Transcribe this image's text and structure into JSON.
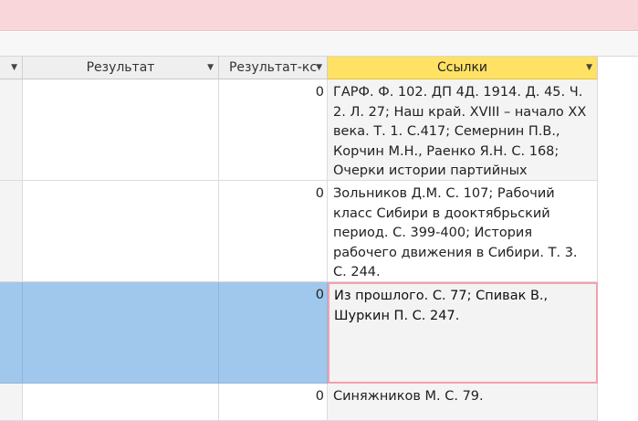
{
  "columns": {
    "result": "Результат",
    "result_ks": "Результат-кс",
    "links": "Ссылки"
  },
  "rows": [
    {
      "result_ks": "0",
      "links": "ГАРФ. Ф. 102. ДП 4Д. 1914. Д. 45. Ч. 2. Л. 27; Наш край. XVIII – начало XX века. Т. 1. С.417; Семернин П.В., Корчин М.Н., Раенко Я.Н. С. 168; Очерки истории партийных"
    },
    {
      "result_ks": "0",
      "links": "Зольников Д.М. С. 107; Рабочий класс Сибири в дооктябрьский период. С. 399-400; История рабочего движения в Сибири. Т. 3. С. 244."
    },
    {
      "result_ks": "0",
      "links": "Из прошлого. С. 77; Спивак В., Шуркин П. С. 247."
    },
    {
      "result_ks": "0",
      "links": "Синяжников М. С. 79."
    }
  ],
  "colors": {
    "banner": "#f8d6d9",
    "active_header": "#ffe164",
    "selection": "#a0c8ec",
    "focus_border": "#f1a0ae"
  }
}
